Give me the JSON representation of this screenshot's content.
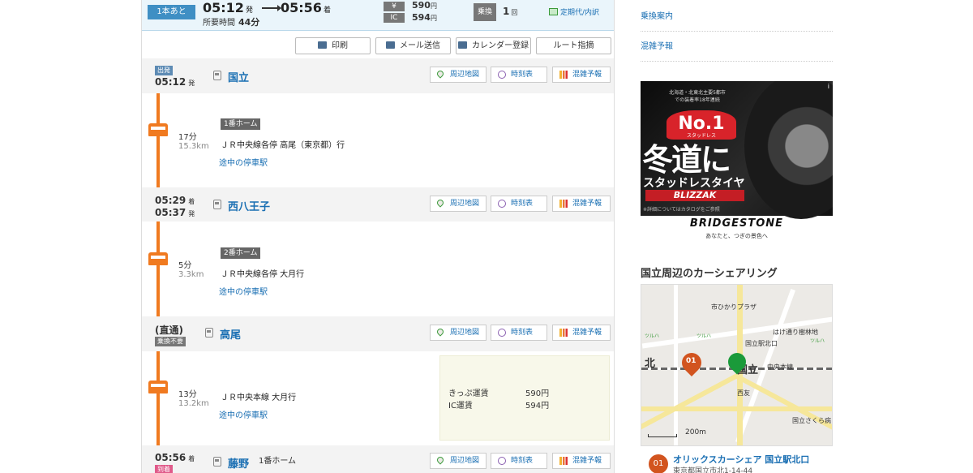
{
  "summary": {
    "next_label": "1本あと",
    "dep_time": "05:12",
    "dep_suffix": "発",
    "arr_time": "05:56",
    "arr_suffix": "着",
    "duration_label": "所要時間",
    "duration_value": "44分",
    "fare_cash_tag": "¥",
    "fare_cash": "590",
    "fare_ic_tag": "IC",
    "fare_ic": "594",
    "yen": "円",
    "transfer_tag": "乗換",
    "transfer_count": "1",
    "transfer_unit": "回",
    "pass_link": "定期代/内訳"
  },
  "toolbar": {
    "print": "印刷",
    "mail": "メール送信",
    "calendar": "カレンダー登録",
    "route": "ルート指摘"
  },
  "station_buttons": {
    "map": "周辺地図",
    "timetable": "時刻表",
    "crowd": "混雑予報"
  },
  "stations": [
    {
      "tag": "出発",
      "time": "05:12",
      "time_suffix": "発",
      "name": "国立"
    },
    {
      "time_arr": "05:29",
      "arr_suffix": "着",
      "time": "05:37",
      "time_suffix": "発",
      "name": "西八王子"
    },
    {
      "label": "(直通)",
      "tag": "乗換不要",
      "name": "高尾"
    },
    {
      "time": "05:56",
      "time_suffix": "着",
      "tag": "到着",
      "name": "藤野",
      "platform": "1番ホーム"
    }
  ],
  "segments": [
    {
      "minutes": "17分",
      "km": "15.3km",
      "platform": "1番ホーム",
      "train": "ＪＲ中央線各停 高尾（東京都）行",
      "link": "途中の停車駅"
    },
    {
      "minutes": "5分",
      "km": "3.3km",
      "platform": "2番ホーム",
      "train": "ＪＲ中央線各停 大月行",
      "link": "途中の停車駅"
    },
    {
      "minutes": "13分",
      "km": "13.2km",
      "train": "ＪＲ中央本線 大月行",
      "link": "途中の停車駅"
    }
  ],
  "fare_box": {
    "ticket_label": "きっぷ運賃",
    "ticket_value": "590円",
    "ic_label": "IC運賃",
    "ic_value": "594円"
  },
  "sidebar": {
    "links": [
      "乗換案内",
      "混雑予報"
    ],
    "ad": {
      "sub": "北海道・北東北主要5都市での装着率18年連続",
      "no1": "No.1",
      "no1_sub": "スタッドレス",
      "headline": "冬道に",
      "tagline": "スタッドレスタイヤ",
      "product": "BLIZZAK",
      "note": "※詳細についてはカタログをご参照",
      "brand": "BRIDGESTONE",
      "slogan": "あなたと、つぎの景色へ",
      "info": "i"
    },
    "carshare_title": "国立周辺のカーシェアリング",
    "map": {
      "labels": [
        "市ひかりプラザ",
        "はけ通り樹林地",
        "国立駅北口",
        "中央本線",
        "北",
        "国立",
        "西友",
        "国立さくら病",
        "ツルハ",
        "ツルハ",
        "ツルハ",
        "200m"
      ]
    },
    "carshare_item": {
      "num": "01",
      "name": "オリックスカーシェア 国立駅北口",
      "address": "東京都国立市北1-14-44"
    }
  }
}
